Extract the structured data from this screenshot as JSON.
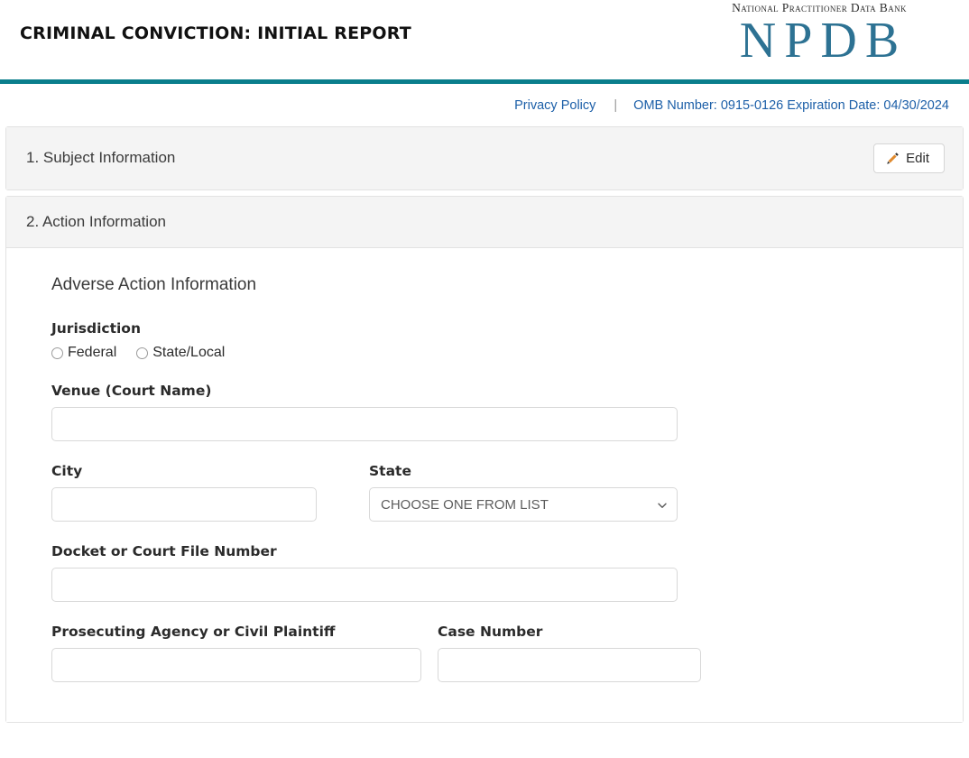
{
  "header": {
    "report_title": "CRIMINAL CONVICTION: INITIAL REPORT",
    "logo_words": "National Practitioner Data Bank",
    "logo_mark": "NPDB",
    "accent_color": "#0a7e8c",
    "logo_color": "#2d7293"
  },
  "meta": {
    "privacy_link": "Privacy Policy",
    "divider": "|",
    "omb_text": "OMB Number: 0915-0126 Expiration Date: 04/30/2024",
    "link_color": "#1c5fa8"
  },
  "sections": {
    "subject": {
      "title": "1. Subject Information",
      "edit_label": "Edit"
    },
    "action": {
      "title": "2. Action Information",
      "subsection_title": "Adverse Action Information",
      "fields": {
        "jurisdiction": {
          "label": "Jurisdiction",
          "options": [
            "Federal",
            "State/Local"
          ],
          "selected": ""
        },
        "venue": {
          "label": "Venue (Court Name)",
          "value": "",
          "placeholder": ""
        },
        "city": {
          "label": "City",
          "value": "",
          "placeholder": ""
        },
        "state": {
          "label": "State",
          "value": "CHOOSE ONE FROM LIST",
          "options": [
            "CHOOSE ONE FROM LIST"
          ]
        },
        "docket": {
          "label": "Docket or Court File Number",
          "value": "",
          "placeholder": ""
        },
        "prosecuting_agency": {
          "label": "Prosecuting Agency or Civil Plaintiff",
          "value": "",
          "placeholder": ""
        },
        "case_number": {
          "label": "Case Number",
          "value": "",
          "placeholder": ""
        }
      }
    }
  }
}
